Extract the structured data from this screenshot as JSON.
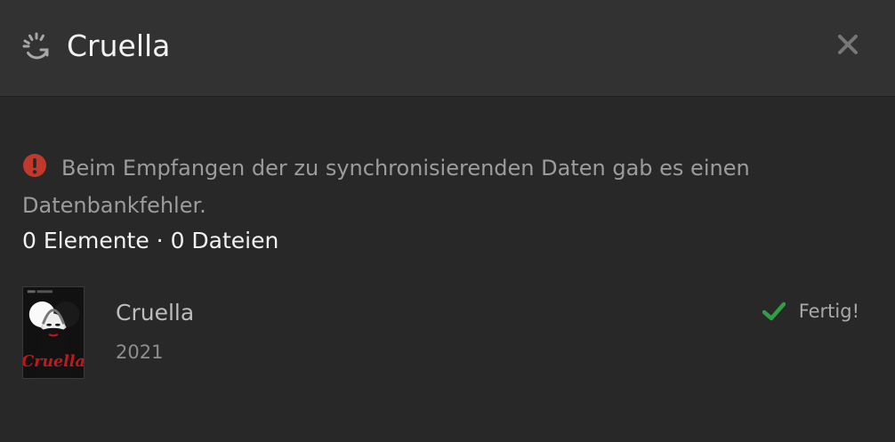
{
  "dialog": {
    "title": "Cruella",
    "icons": {
      "sync": "sync-loading-icon",
      "close": "close-icon"
    }
  },
  "error": {
    "icon": "error-exclamation-icon",
    "message": "Beim Empfangen der zu synchronisierenden Daten gab es einen Datenbankfehler."
  },
  "summary": {
    "counts": "0 Elemente · 0 Dateien"
  },
  "item": {
    "title": "Cruella",
    "year": "2021",
    "poster_title_art": "Cruella",
    "status_icon": "check-icon",
    "status": "Fertig!"
  },
  "colors": {
    "background": "#282828",
    "header": "#323232",
    "error_red": "#c0392b",
    "success_green": "#2f9e44",
    "poster_red": "#c4161c"
  }
}
